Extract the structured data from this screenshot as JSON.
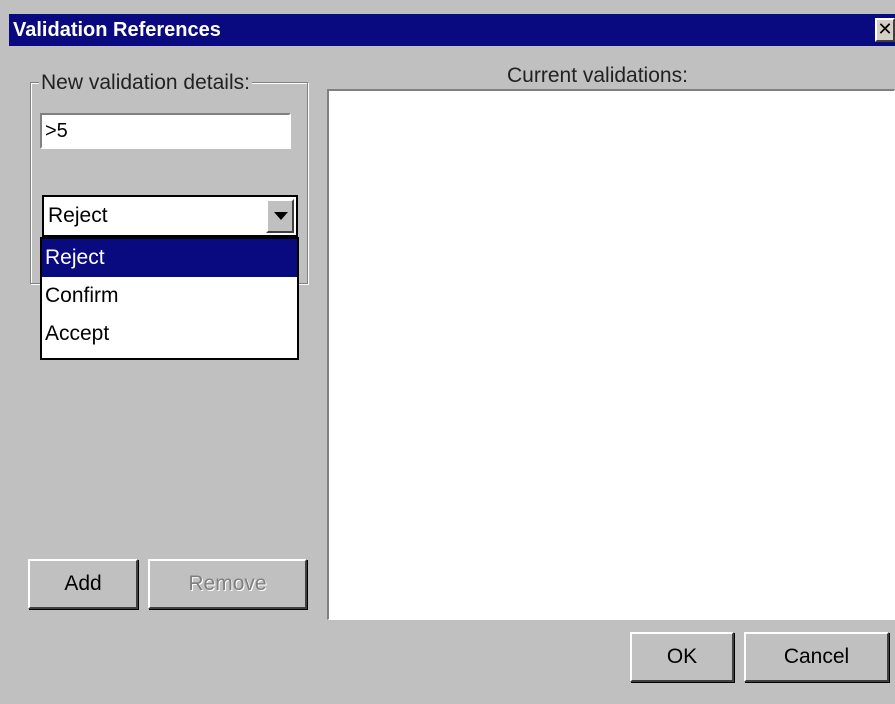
{
  "window": {
    "title": "Validation References",
    "close_glyph": "✕"
  },
  "new_details": {
    "legend": "New validation details:",
    "value": ">5"
  },
  "combo": {
    "selected": "Reject",
    "options": [
      "Reject",
      "Confirm",
      "Accept"
    ],
    "highlighted_index": 0
  },
  "buttons": {
    "add": "Add",
    "remove": "Remove",
    "ok": "OK",
    "cancel": "Cancel"
  },
  "current": {
    "label": "Current validations:",
    "items": []
  },
  "colors": {
    "title_bar": "#0a0a80",
    "face": "#c0c0c0",
    "selection": "#0a0a80"
  },
  "icons": {
    "close": "close-icon",
    "dropdown": "chevron-down-icon"
  }
}
